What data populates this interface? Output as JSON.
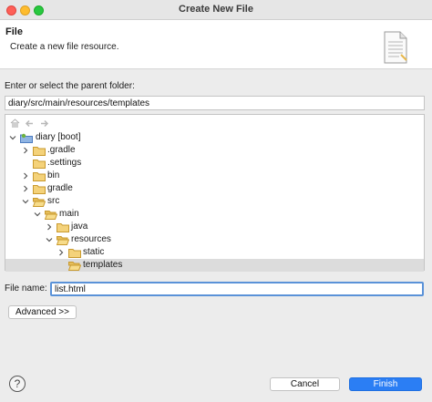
{
  "window": {
    "title": "Create New File"
  },
  "header": {
    "title": "File",
    "description": "Create a new file resource.",
    "icon": "new-file-wizard-icon"
  },
  "parent_folder": {
    "label": "Enter or select the parent folder:",
    "value": "diary/src/main/resources/templates"
  },
  "tree_toolbar": {
    "buttons": [
      "home-icon",
      "back-arrow-icon",
      "forward-arrow-icon"
    ]
  },
  "tree": {
    "items": [
      {
        "label": "diary [boot]",
        "expanded": true
      },
      {
        "label": ".gradle",
        "expanded": false
      },
      {
        "label": ".settings",
        "expanded": null
      },
      {
        "label": "bin",
        "expanded": false
      },
      {
        "label": "gradle",
        "expanded": false
      },
      {
        "label": "src",
        "expanded": true
      },
      {
        "label": "main",
        "expanded": true
      },
      {
        "label": "java",
        "expanded": false
      },
      {
        "label": "resources",
        "expanded": true
      },
      {
        "label": "static",
        "expanded": false
      },
      {
        "label": "templates",
        "expanded": null,
        "selected": true
      }
    ]
  },
  "file_name": {
    "label": "File name:",
    "value": "list.html"
  },
  "buttons": {
    "advanced": "Advanced >>",
    "help": "?",
    "cancel": "Cancel",
    "finish": "Finish"
  },
  "colors": {
    "primary_button": "#2b7ef4",
    "focus_ring": "#5a92d8",
    "folder": "#e7b74a"
  }
}
